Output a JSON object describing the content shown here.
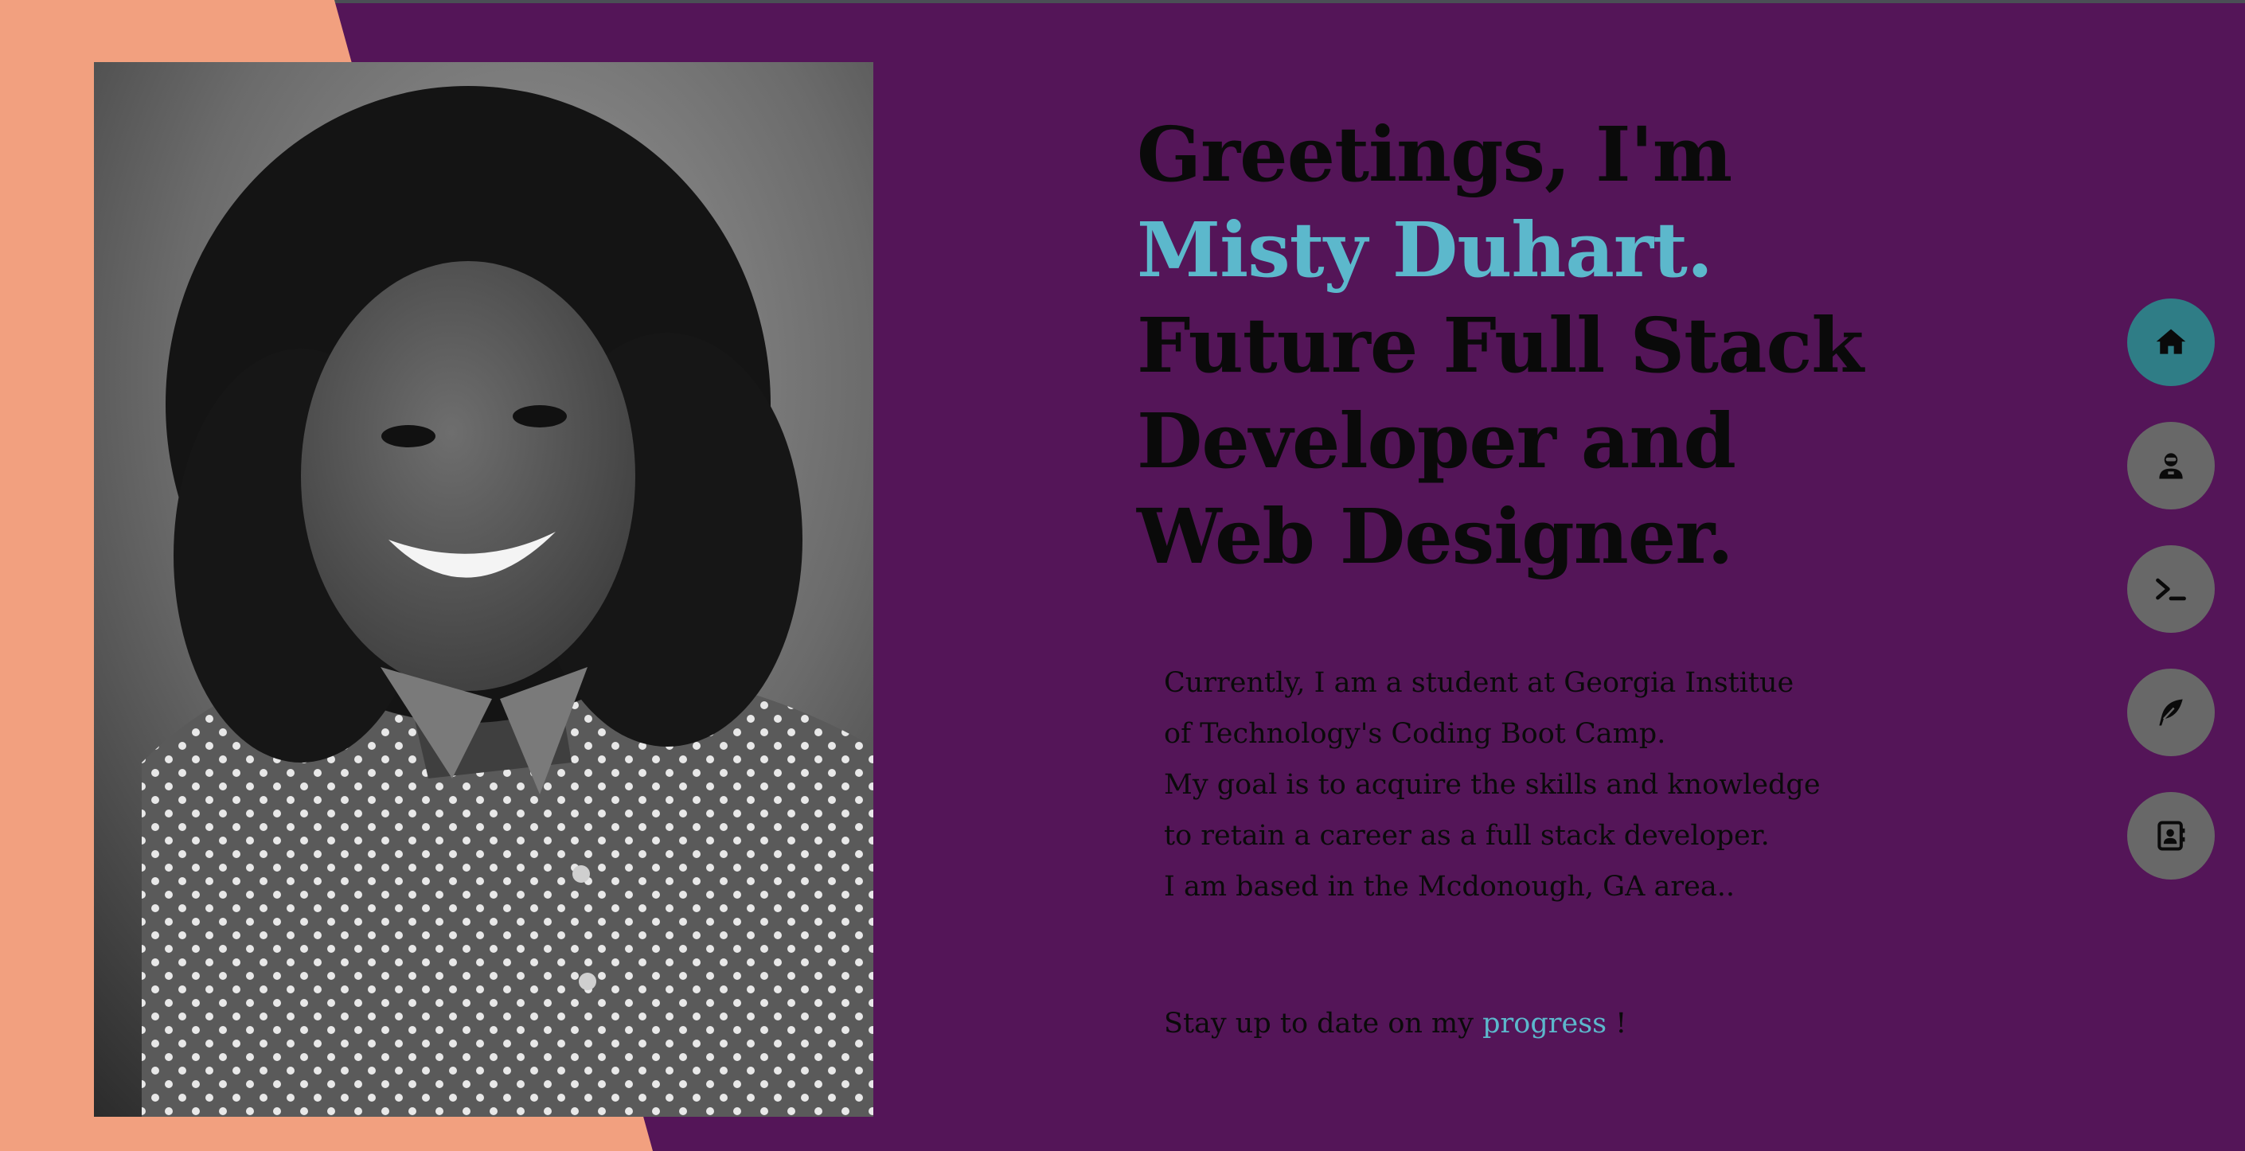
{
  "headline": {
    "line1": "Greetings, I'm",
    "name": "Misty Duhart.",
    "line3": "Future Full Stack",
    "line4": "Developer and",
    "line5": "Web Designer."
  },
  "bio": {
    "line1": "Currently, I am a student at Georgia Institue",
    "line2": "of Technology's Coding Boot Camp.",
    "line3": "My goal is to acquire the skills and knowledge",
    "line4": "to retain a career as a full stack developer.",
    "line5": "I am based in the Mcdonough, GA area.."
  },
  "progress": {
    "prefix": "Stay up to date on my ",
    "link": "progress",
    "suffix": " !"
  },
  "nav": {
    "items": [
      {
        "icon": "home-icon",
        "active": true
      },
      {
        "icon": "user-icon",
        "active": false
      },
      {
        "icon": "terminal-icon",
        "active": false
      },
      {
        "icon": "feather-icon",
        "active": false
      },
      {
        "icon": "contact-book-icon",
        "active": false
      }
    ]
  },
  "colors": {
    "background": "#541558",
    "accent_peach": "#f2a07f",
    "accent_teal": "#5cb8cc",
    "nav_active": "#2f7d86",
    "nav_inactive": "#686868"
  }
}
